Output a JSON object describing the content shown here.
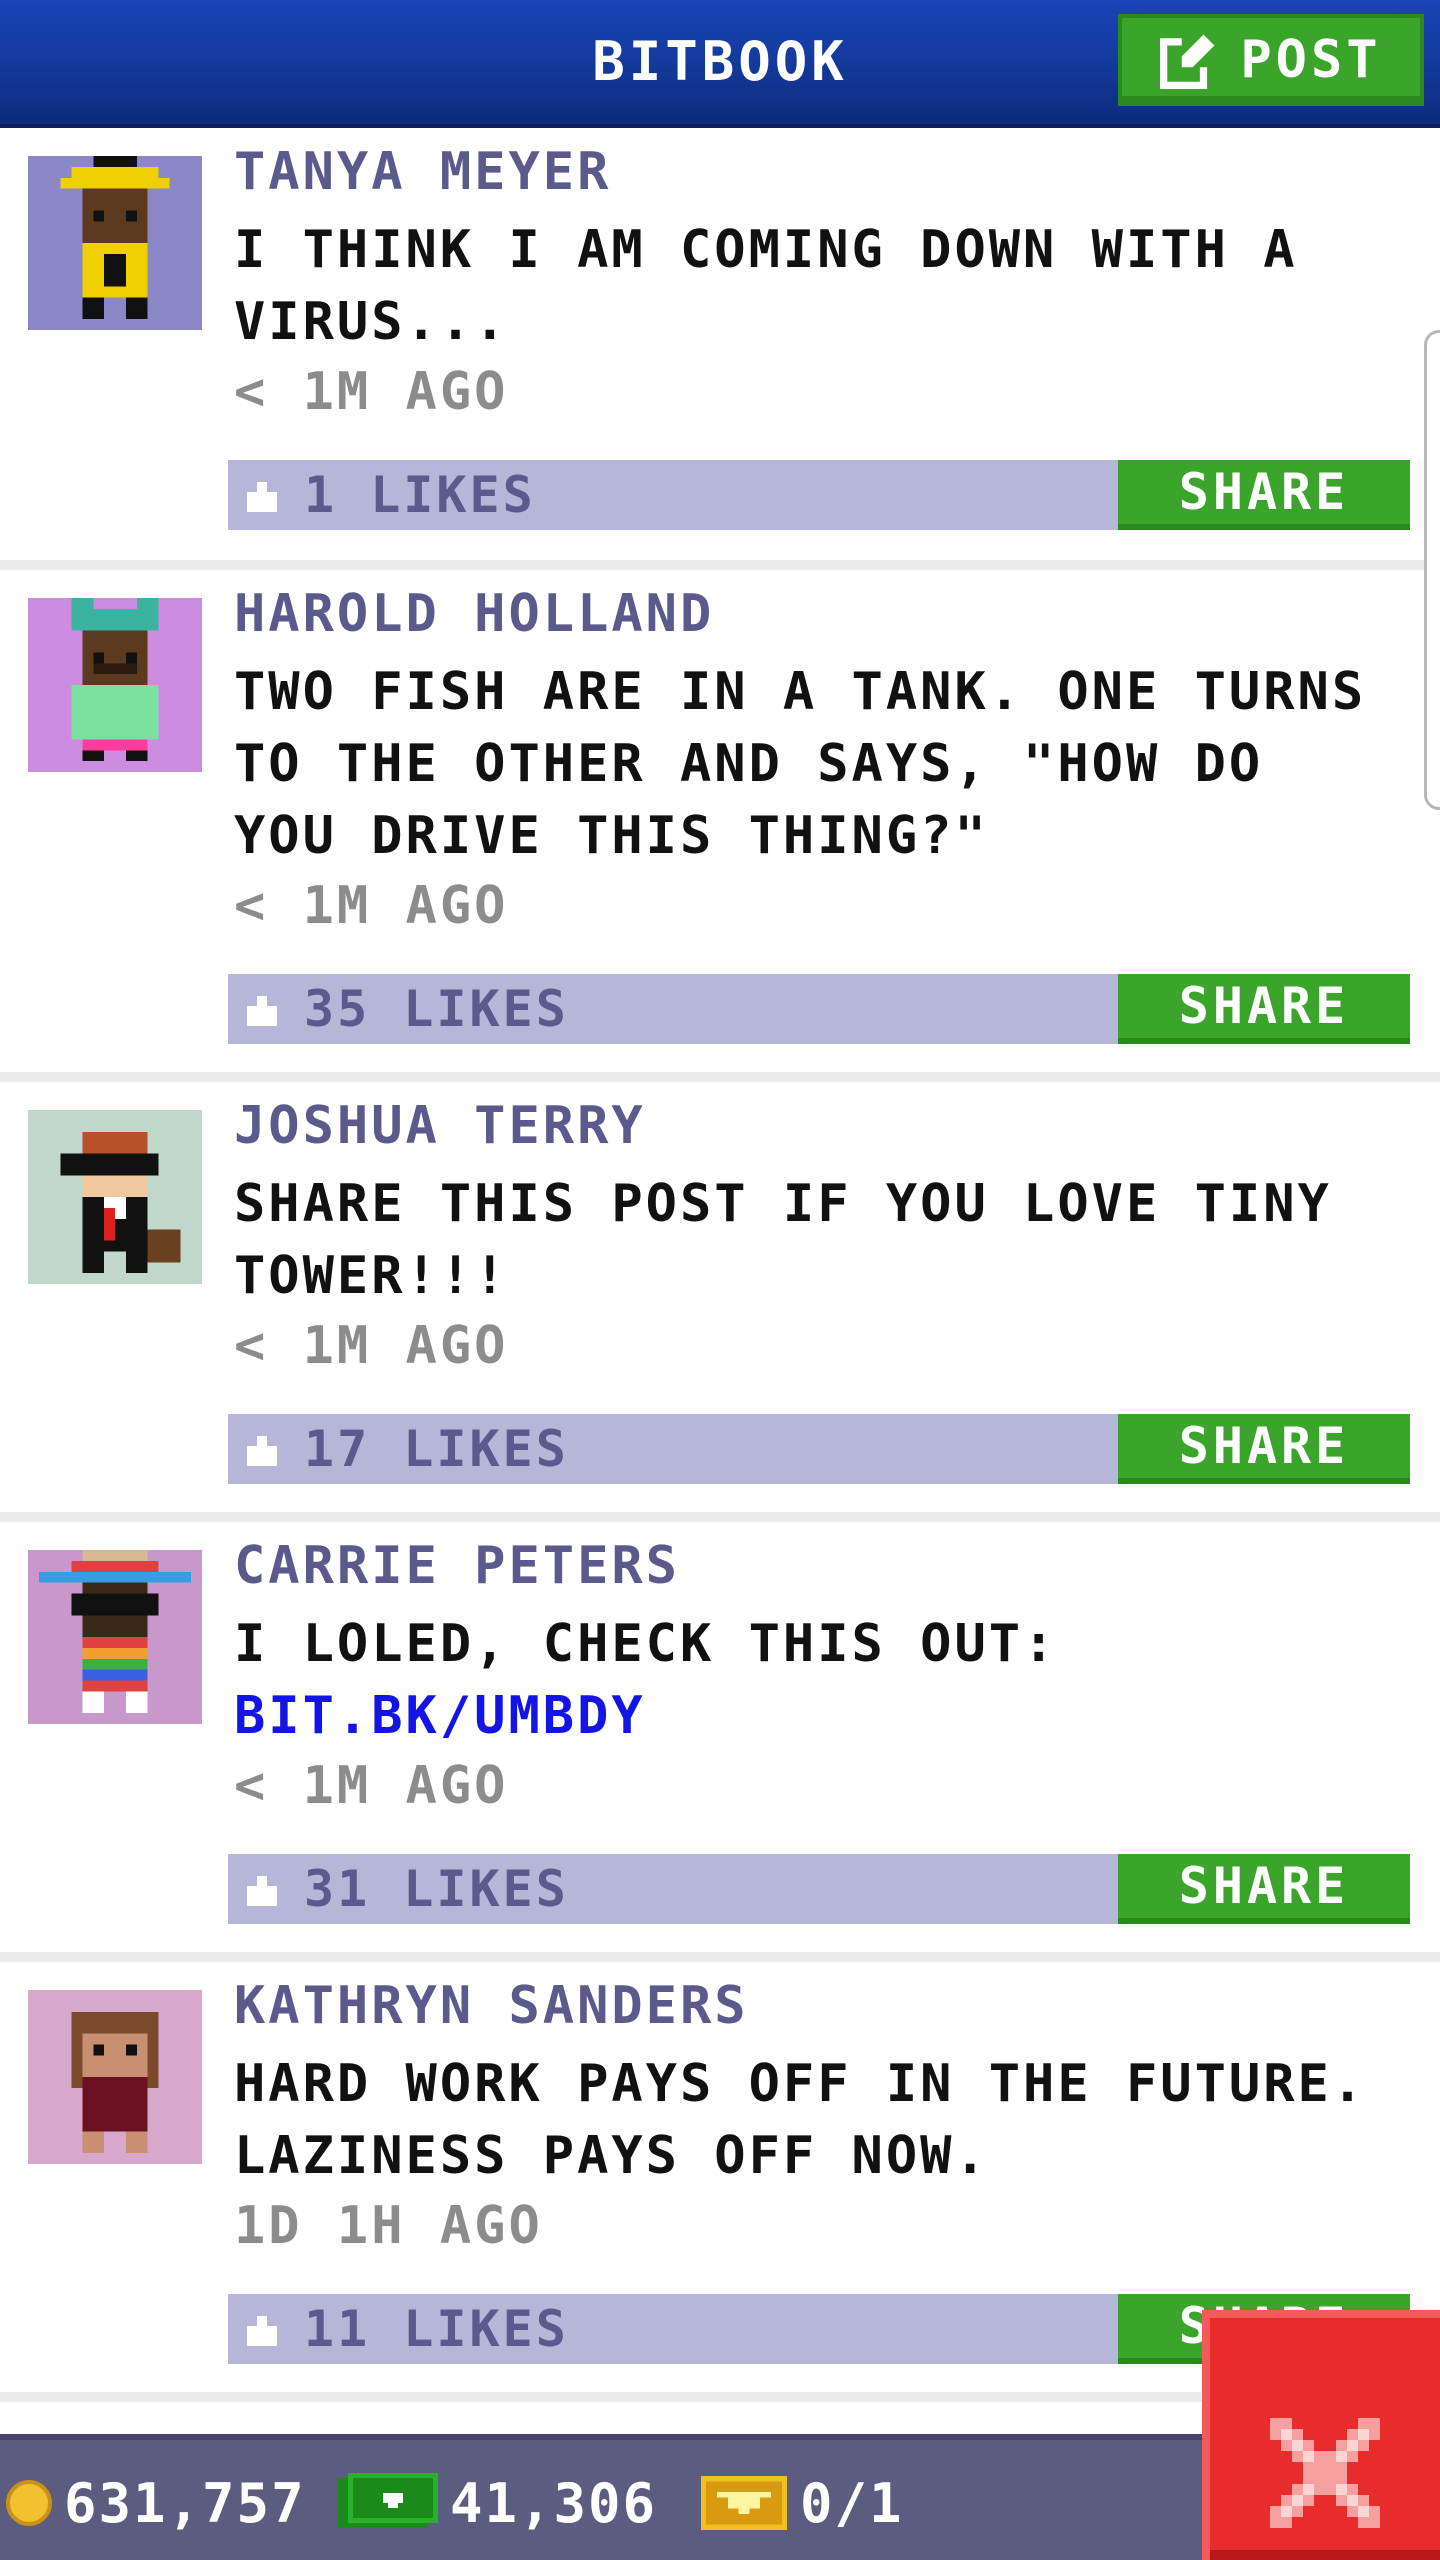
{
  "header": {
    "title": "BITBOOK",
    "post_label": "POST",
    "post_icon": "edit-icon",
    "background": "#133a9c"
  },
  "posts": [
    {
      "name": "TANYA MEYER",
      "message": "I THINK I AM COMING DOWN WITH A VIRUS...",
      "link": "",
      "time": "< 1M AGO",
      "likes": "1 LIKES",
      "share_label": "SHARE",
      "avatar_bg": "#8c88c8"
    },
    {
      "name": "HAROLD HOLLAND",
      "message": "TWO FISH ARE IN A TANK. ONE TURNS TO THE OTHER AND SAYS, \"HOW DO YOU DRIVE THIS THING?\"",
      "link": "",
      "time": "< 1M AGO",
      "likes": "35 LIKES",
      "share_label": "SHARE",
      "avatar_bg": "#cc8ce0"
    },
    {
      "name": "JOSHUA TERRY",
      "message": "SHARE THIS POST IF YOU LOVE TINY TOWER!!!",
      "link": "",
      "time": "< 1M AGO",
      "likes": "17 LIKES",
      "share_label": "SHARE",
      "avatar_bg": "#c0d8cc"
    },
    {
      "name": "CARRIE PETERS",
      "message": "I LOLED, CHECK THIS OUT:",
      "link": "BIT.BK/UMBDY",
      "time": "< 1M AGO",
      "likes": "31 LIKES",
      "share_label": "SHARE",
      "avatar_bg": "#c898cc"
    },
    {
      "name": "KATHRYN SANDERS",
      "message": "HARD WORK PAYS OFF IN THE FUTURE. LAZINESS PAYS OFF NOW.",
      "link": "",
      "time": "1D 1H AGO",
      "likes": "11 LIKES",
      "share_label": "SHARE",
      "avatar_bg": "#d8a8cc"
    }
  ],
  "status": {
    "coins": "631,757",
    "bux": "41,306",
    "vip": "0/1",
    "coin_icon": "coin-icon",
    "bux_icon": "bux-icon",
    "vip_icon": "vip-ticket-icon"
  },
  "close_icon": "close-icon",
  "colors": {
    "accent_green": "#3aa52a",
    "like_bar": "#b6b6d8",
    "name_color": "#5a5a8c",
    "link_color": "#1414e6",
    "close_red": "#e82c2c"
  }
}
